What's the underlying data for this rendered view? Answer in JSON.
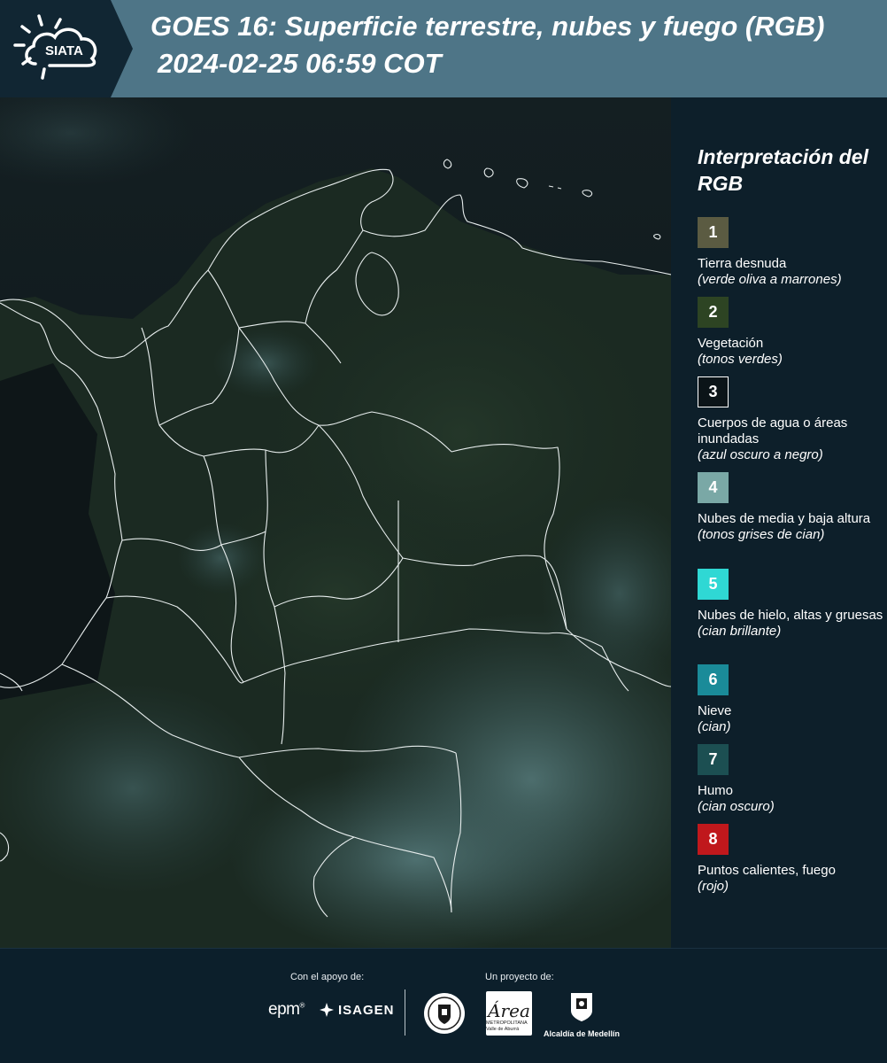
{
  "header": {
    "logo_text": "SIATA",
    "title_line1": "GOES 16: Superficie terrestre, nubes y fuego (RGB)",
    "title_line2": "2024-02-25 06:59 COT"
  },
  "legend": {
    "title": "Interpretación del RGB",
    "items": [
      {
        "number": "1",
        "label": "Tierra desnuda",
        "sub": "(verde oliva a marrones)",
        "color": "#5b5b42"
      },
      {
        "number": "2",
        "label": "Vegetación",
        "sub": "(tonos verdes)",
        "color": "#2d4423"
      },
      {
        "number": "3",
        "label": "Cuerpos de agua o áreas inundadas",
        "sub": "(azul oscuro a negro)",
        "color": "#0b1418"
      },
      {
        "number": "4",
        "label": "Nubes de media y baja altura",
        "sub": "(tonos grises de cian)",
        "color": "#7aa8a6"
      },
      {
        "number": "5",
        "label": "Nubes de hielo, altas y gruesas",
        "sub": "(cian brillante)",
        "color": "#2fd8d4"
      },
      {
        "number": "6",
        "label": "Nieve",
        "sub": "(cian)",
        "color": "#1a8b99"
      },
      {
        "number": "7",
        "label": "Humo",
        "sub": "(cian oscuro)",
        "color": "#1c4f52"
      },
      {
        "number": "8",
        "label": "Puntos calientes, fuego",
        "sub": "(rojo)",
        "color": "#c0181c"
      }
    ]
  },
  "footer": {
    "support_label": "Con el apoyo de:",
    "project_label": "Un proyecto de:",
    "epm_text": "epm",
    "isagen_text": "ISAGEN",
    "area_text": "Área",
    "area_sub": "METROPOLITANA Valle de Aburrá",
    "medellin_text": "Alcaldía de Medellín"
  },
  "colors": {
    "header_bg": "#4e7587",
    "page_bg": "#0d1f2a",
    "land_green": "#1c2a1e",
    "cloud_cyan": "#3f6466"
  }
}
